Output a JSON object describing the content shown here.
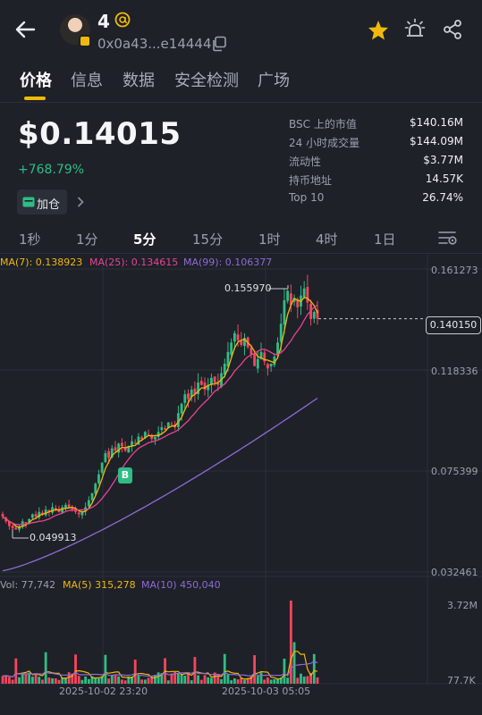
{
  "header": {
    "back_icon": "back-arrow-icon",
    "token_name": "4",
    "at_icon": "at-sign-icon",
    "address": "0x0a43...e14444",
    "copy_icon": "copy-icon",
    "star_icon": "star-icon",
    "alert_icon": "alarm-light-icon",
    "share_icon": "share-icon"
  },
  "tabs": [
    "价格",
    "信息",
    "数据",
    "安全检测",
    "广场"
  ],
  "price": {
    "value": "$0.14015",
    "change": "+768.79%",
    "add_label": "加仓",
    "up_color": "#2ebd85",
    "accent_color": "#f0b90b"
  },
  "stats": [
    {
      "label": "BSC 上的市值",
      "value": "$140.16M"
    },
    {
      "label": "24 小时成交量",
      "value": "$144.09M"
    },
    {
      "label": "流动性",
      "value": "$3.77M"
    },
    {
      "label": "持币地址",
      "value": "14.57K"
    },
    {
      "label": "Top 10",
      "value": "26.74%"
    }
  ],
  "intervals": [
    "1秒",
    "1分",
    "5分",
    "15分",
    "1时",
    "4时",
    "1日"
  ],
  "active_interval": "5分",
  "chart": {
    "ma_legend": [
      "MA(7): 0.138923",
      "MA(25): 0.134615",
      "MA(99): 0.106377"
    ],
    "ma_colors": [
      "#f0b90b",
      "#e84393",
      "#8e6bd8"
    ],
    "price_axis": [
      "0.161273",
      "0.118336",
      "0.075399",
      "0.032461"
    ],
    "last_price": "0.140150",
    "high_marker": "0.155970",
    "low_marker": "0.049913",
    "buy_marker": "B",
    "volume_legend": [
      "Vol: 77,742",
      "MA(5) 315,278",
      "MA(10) 450,040"
    ],
    "volume_axis": [
      "3.72M",
      "77.7K"
    ],
    "time_labels": [
      "2025-10-02 23:20",
      "2025-10-03 05:05"
    ]
  },
  "chart_data": {
    "type": "candlestick",
    "interval": "5分",
    "y_axis_ticks": [
      0.161273,
      0.118336,
      0.075399,
      0.032461
    ],
    "last_price": 0.14015,
    "high": 0.15597,
    "low": 0.049913,
    "x_tick_labels": [
      "2025-10-02 23:20",
      "2025-10-03 05:05"
    ],
    "close_series": [
      0.056,
      0.054,
      0.052,
      0.051,
      0.0505,
      0.052,
      0.054,
      0.053,
      0.055,
      0.057,
      0.056,
      0.058,
      0.057,
      0.059,
      0.058,
      0.06,
      0.059,
      0.058,
      0.06,
      0.061,
      0.06,
      0.059,
      0.058,
      0.057,
      0.058,
      0.06,
      0.063,
      0.066,
      0.07,
      0.074,
      0.079,
      0.083,
      0.081,
      0.085,
      0.084,
      0.087,
      0.086,
      0.084,
      0.086,
      0.088,
      0.087,
      0.09,
      0.089,
      0.092,
      0.091,
      0.089,
      0.09,
      0.092,
      0.094,
      0.093,
      0.096,
      0.095,
      0.094,
      0.1,
      0.104,
      0.108,
      0.106,
      0.11,
      0.108,
      0.113,
      0.112,
      0.11,
      0.112,
      0.115,
      0.113,
      0.112,
      0.117,
      0.121,
      0.126,
      0.13,
      0.134,
      0.131,
      0.129,
      0.132,
      0.128,
      0.125,
      0.12,
      0.123,
      0.126,
      0.122,
      0.119,
      0.121,
      0.124,
      0.13,
      0.138,
      0.148,
      0.152,
      0.146,
      0.149,
      0.145,
      0.15,
      0.153,
      0.147,
      0.14,
      0.143,
      0.14015
    ],
    "ma_series": [
      {
        "name": "MA(7)",
        "last": 0.138923
      },
      {
        "name": "MA(25)",
        "last": 0.134615
      },
      {
        "name": "MA(99)",
        "last": 0.106377
      }
    ],
    "volume": {
      "axis_max": "3.72M",
      "axis_min": "77.7K",
      "last": 77742,
      "ma5": 315278,
      "ma10": 450040
    }
  }
}
